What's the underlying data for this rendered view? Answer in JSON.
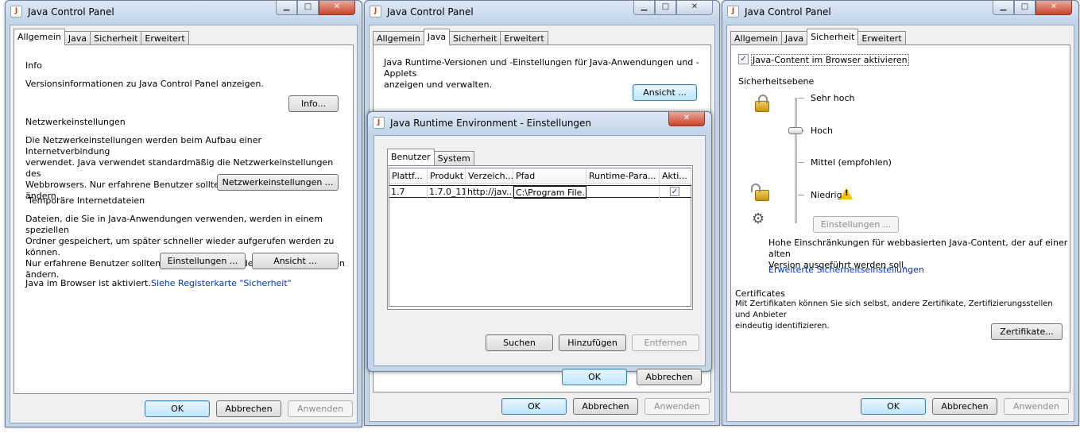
{
  "panel1": {
    "title": "Java Control Panel",
    "tabs": [
      "Allgemein",
      "Java",
      "Sicherheit",
      "Erweitert"
    ],
    "info_heading": "Info",
    "info_text": "Versionsinformationen zu Java Control Panel anzeigen.",
    "info_button": "Info...",
    "net_heading": "Netzwerkeinstellungen",
    "net_text": [
      "Die Netzwerkeinstellungen werden beim Aufbau einer Internetverbindung",
      "verwendet. Java verwendet standardmäßig die Netzwerkeinstellungen des",
      "Webbrowsers. Nur erfahrene Benutzer sollten diese Einstellungen ändern."
    ],
    "net_button": "Netzwerkeinstellungen ...",
    "temp_heading": "Temporäre Internetdateien",
    "temp_text": [
      "Dateien, die Sie in Java-Anwendungen verwenden, werden in einem speziellen",
      "Ordner gespeichert, um später schneller wieder aufgerufen werden zu können.",
      "Nur erfahrene Benutzer sollten Dateien löschen oder diese Einstellungen ändern."
    ],
    "settings_button": "Einstellungen ...",
    "view_button": "Ansicht ...",
    "browser_status": "Java im Browser ist aktiviert.",
    "browser_link": "Siehe Registerkarte \"Sicherheit\"",
    "ok": "OK",
    "cancel": "Abbrechen",
    "apply": "Anwenden"
  },
  "panel2": {
    "title": "Java Control Panel",
    "tabs": [
      "Allgemein",
      "Java",
      "Sicherheit",
      "Erweitert"
    ],
    "text": [
      "Java Runtime-Versionen und -Einstellungen für Java-Anwendungen und -Applets",
      "anzeigen und verwalten."
    ],
    "view_button": "Ansicht ...",
    "ok": "OK",
    "cancel": "Abbrechen",
    "apply": "Anwenden"
  },
  "jre_dialog": {
    "title": "Java Runtime Environment - Einstellungen",
    "tabs": [
      "Benutzer",
      "System"
    ],
    "columns": [
      "Plattf...",
      "Produkt",
      "Verzeich...",
      "Pfad",
      "Runtime-Para...",
      "Akti..."
    ],
    "row": {
      "platform": "1.7",
      "product": "1.7.0_11",
      "location": "http://jav...",
      "path": "C:\\Program File...",
      "params": "",
      "enabled": "✓"
    },
    "search": "Suchen",
    "add": "Hinzufügen",
    "remove": "Entfernen",
    "ok": "OK",
    "cancel": "Abbrechen"
  },
  "panel3": {
    "title": "Java Control Panel",
    "tabs": [
      "Allgemein",
      "Java",
      "Sicherheit",
      "Erweitert"
    ],
    "enable_label": "Java-Content im Browser aktivieren",
    "enable_check": "✓",
    "level_heading": "Sicherheitsebene",
    "levels": [
      "Sehr hoch",
      "Hoch",
      "Mittel (empfohlen)",
      "Niedrig"
    ],
    "warn_glyph": "!",
    "custom_button": "Einstellungen ...",
    "level_desc": [
      "Hohe Einschränkungen für webbasierten Java-Content, der auf einer alten",
      "Version ausgeführt werden soll."
    ],
    "advanced_link": "Erweiterte Sicherheitseinstellungen",
    "cert_heading": "Certificates",
    "cert_text": [
      "Mit Zertifikaten können Sie sich selbst, andere Zertifikate, Zertifizierungsstellen und Anbieter",
      "eindeutig identifizieren."
    ],
    "cert_button": "Zertifikate...",
    "ok": "OK",
    "cancel": "Abbrechen",
    "apply": "Anwenden"
  },
  "window_buttons": {
    "minimize": "▁",
    "maximize": "□",
    "close": "✕"
  },
  "app_icon_glyph": "J"
}
